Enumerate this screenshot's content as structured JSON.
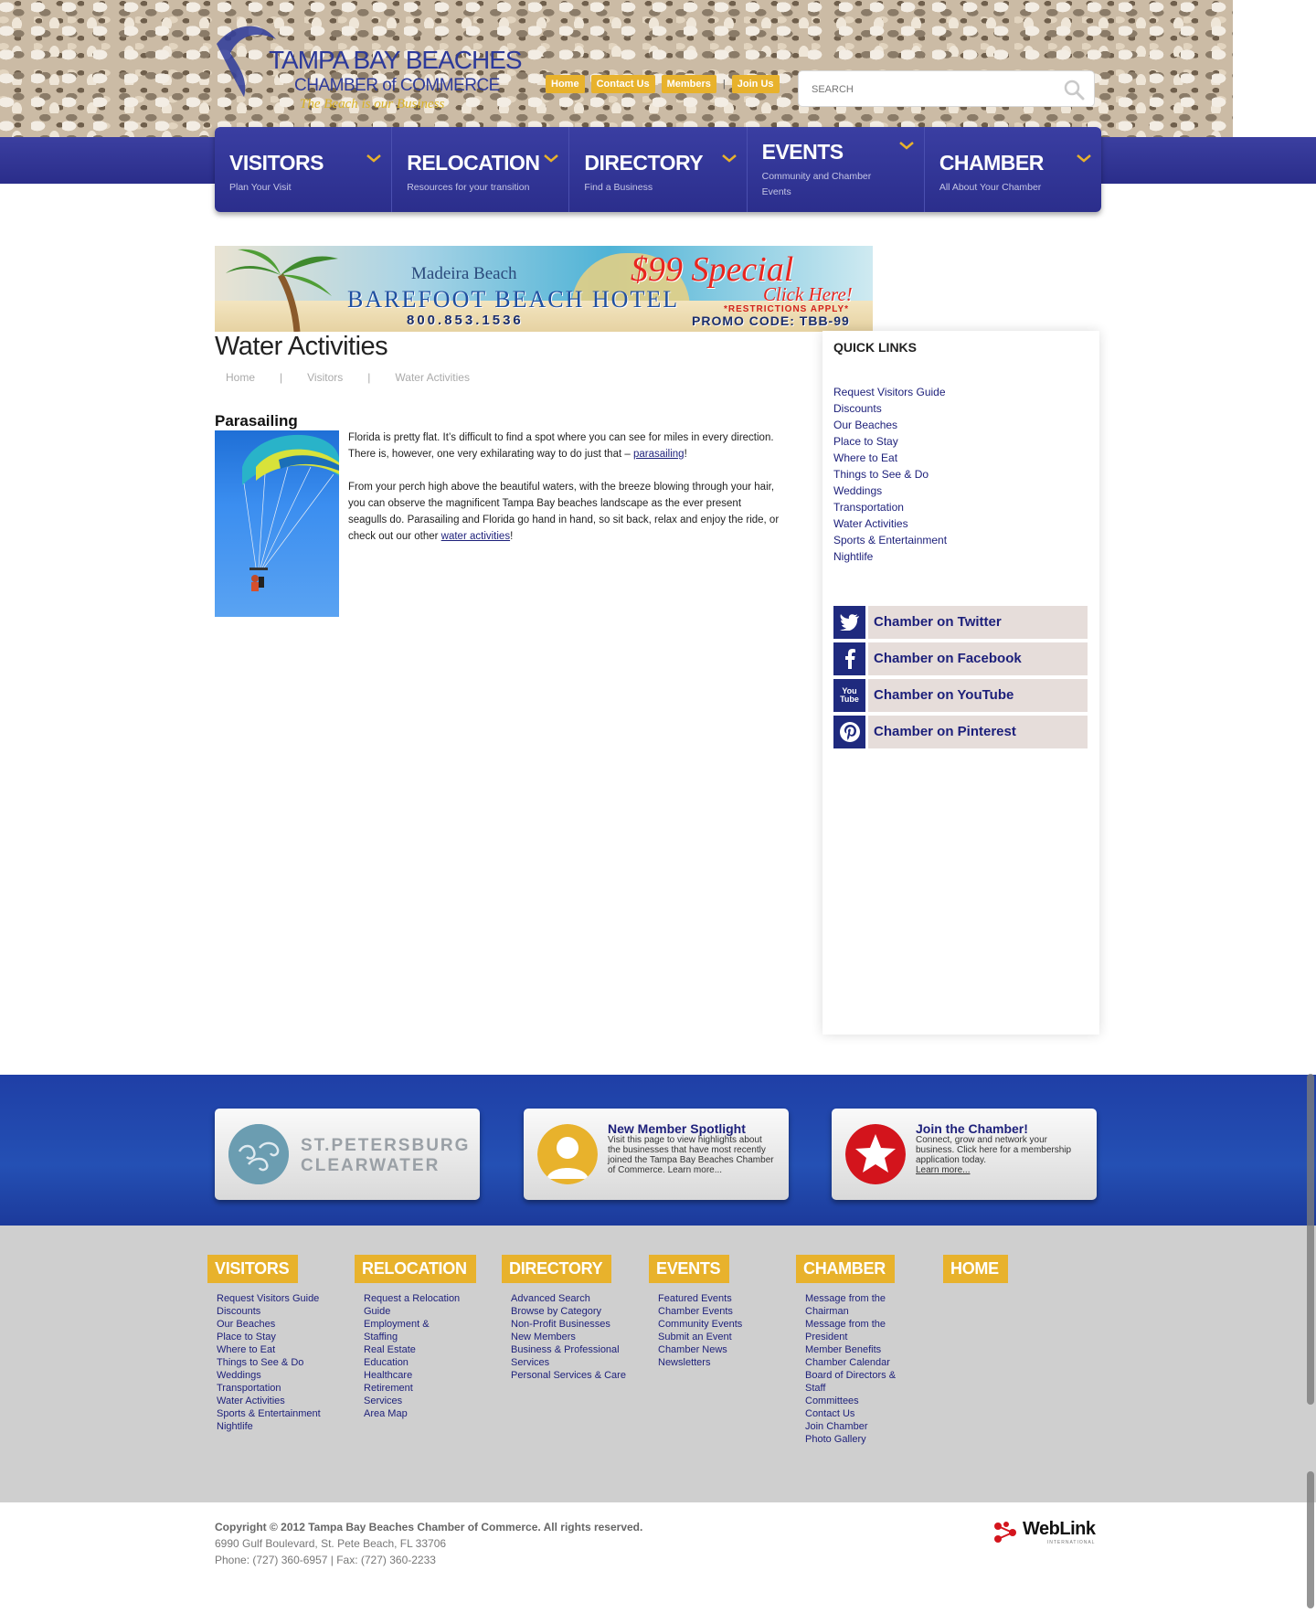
{
  "brand": {
    "line1": "TAMPA BAY BEACHES",
    "line2": "CHAMBER of COMMERCE",
    "tagline": "The Beach is our Business"
  },
  "topnav": {
    "home": "Home",
    "contact": "Contact Us",
    "members": "Members",
    "join": "Join Us"
  },
  "search": {
    "placeholder": "SEARCH"
  },
  "mainnav": [
    {
      "title": "VISITORS",
      "sub": "Plan Your Visit"
    },
    {
      "title": "RELOCATION",
      "sub": "Resources for your transition"
    },
    {
      "title": "DIRECTORY",
      "sub": "Find a Business"
    },
    {
      "title": "EVENTS",
      "sub": "Community and Chamber Events"
    },
    {
      "title": "CHAMBER",
      "sub": "All About Your Chamber"
    }
  ],
  "banner": {
    "place": "Madeira Beach",
    "hotel": "BAREFOOT BEACH HOTEL",
    "phone": "800.853.1536",
    "special": "$99 Special",
    "click": "Click Here!",
    "restrictions": "*RESTRICTIONS APPLY*",
    "promo": "PROMO CODE: TBB-99"
  },
  "page": {
    "title": "Water Activities",
    "breadcrumb": [
      "Home",
      "Visitors",
      "Water Activities"
    ],
    "section_title": "Parasailing",
    "p1_before": "Florida is pretty flat. It’s difficult to find a spot where you can see for miles in every direction. There is, however, one very exhilarating way to do just that – ",
    "p1_link": "parasailing",
    "p1_after": "!",
    "p2_before": "From your perch high above the beautiful waters, with the breeze blowing through your hair, you can observe the magnificent Tampa Bay beaches landscape as the ever present seagulls do. Parasailing and Florida go hand in hand, so sit back, relax and enjoy the ride, or check out our other ",
    "p2_link": "water activities",
    "p2_after": "!"
  },
  "sidebar": {
    "title": "QUICK LINKS",
    "links": [
      "Request Visitors Guide",
      "Discounts",
      "Our Beaches",
      "Place to Stay",
      "Where to Eat",
      "Things to See & Do",
      "Weddings",
      "Transportation",
      "Water Activities",
      "Sports & Entertainment",
      "Nightlife"
    ],
    "social": {
      "twitter": "Chamber on Twitter",
      "facebook": "Chamber on Facebook",
      "youtube": "Chamber on YouTube",
      "pinterest": "Chamber on Pinterest"
    },
    "youtube_icon_text": [
      "You",
      "Tube"
    ]
  },
  "promos": {
    "stpete": [
      "ST.PETERSBURG",
      "CLEARWATER"
    ],
    "spotlight": {
      "title": "New Member Spotlight",
      "body": "Visit this page to view highlights about the businesses that have most recently joined the Tampa Bay Beaches Chamber of Commerce.",
      "more": "Learn more..."
    },
    "join": {
      "title": "Join the Chamber!",
      "body": "Connect, grow and network your business. Click here for a membership application today.",
      "more": "Learn more..."
    }
  },
  "footer": {
    "visitors": {
      "title": "VISITORS",
      "links": [
        "Request Visitors Guide",
        "Discounts",
        "Our Beaches",
        "Place to Stay",
        "Where to Eat",
        "Things to See & Do",
        "Weddings",
        "Transportation",
        "Water Activities",
        "Sports & Entertainment",
        "Nightlife"
      ]
    },
    "relocation": {
      "title": "RELOCATION",
      "links": [
        "Request a Relocation Guide",
        "Employment & Staffing",
        "Real Estate",
        "Education",
        "Healthcare",
        "Retirement",
        "Services",
        "Area Map"
      ]
    },
    "directory": {
      "title": "DIRECTORY",
      "links": [
        "Advanced Search",
        "Browse by Category",
        "Non-Profit Businesses",
        "New Members",
        "Business & Professional Services",
        "Personal Services & Care"
      ]
    },
    "events": {
      "title": "EVENTS",
      "links": [
        "Featured Events",
        "Chamber Events",
        "Community Events",
        "Submit an Event",
        "Chamber News",
        "Newsletters"
      ]
    },
    "chamber": {
      "title": "CHAMBER",
      "links": [
        "Message from the Chairman",
        "Message from the President",
        "Member Benefits",
        "Chamber Calendar",
        "Board of Directors & Staff",
        "Committees",
        "Contact Us",
        "Join Chamber",
        "Photo Gallery"
      ]
    },
    "home": {
      "title": "HOME"
    }
  },
  "bottom": {
    "copyright": "Copyright © 2012 Tampa Bay Beaches Chamber of Commerce.  All rights reserved.",
    "address": "6990 Gulf Boulevard, St. Pete Beach, FL 33706",
    "phone": "Phone: (727) 360-6957 | Fax: (727) 360-2233",
    "weblink": "WebLink",
    "weblink_sub": "INTERNATIONAL"
  },
  "colors": {
    "nav_blue": "#2b2e8c",
    "gold": "#e8b22c",
    "link": "#1c1f7a"
  },
  "icons": [
    "search-icon",
    "chevron-down-icon",
    "twitter-icon",
    "facebook-icon",
    "youtube-icon",
    "pinterest-icon",
    "person-icon",
    "star-icon",
    "wave-logo-icon"
  ]
}
